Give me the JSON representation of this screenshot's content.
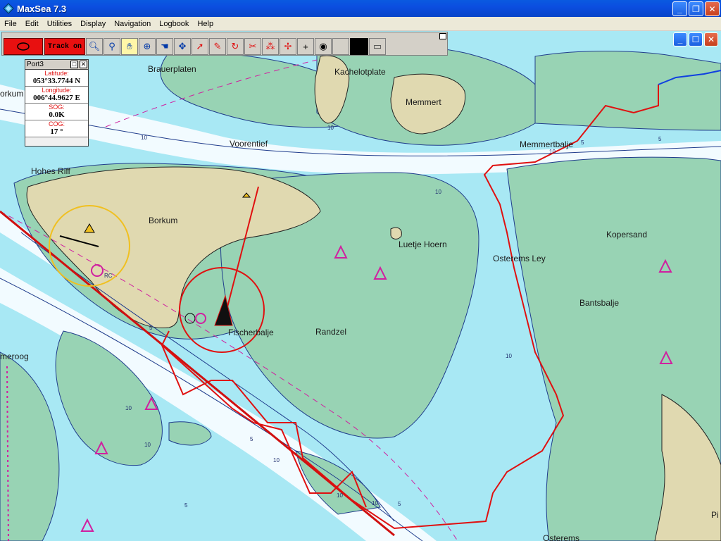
{
  "window": {
    "title": "MaxSea 7.3"
  },
  "menu": [
    "File",
    "Edit",
    "Utilities",
    "Display",
    "Navigation",
    "Logbook",
    "Help"
  ],
  "toolbar": {
    "track_label": "Track on",
    "tools": [
      "zoom-icon",
      "compass-icon",
      "hand-icon",
      "crosshair-icon",
      "hand-icon",
      "route-icon",
      "pointer-icon",
      "pencil-icon",
      "cycle-icon",
      "scissors-icon",
      "scatter-icon",
      "move-icon",
      "plus-icon",
      "target-icon"
    ]
  },
  "gps_panel": {
    "title": "Port3",
    "latitude_label": "Latitude:",
    "latitude": "053°33.7744 N",
    "longitude_label": "Longitude:",
    "longitude": "006°44.9627 E",
    "sog_label": "SOG:",
    "sog": "0.0K",
    "cog_label": "COG:",
    "cog": "17 °"
  },
  "map": {
    "places": {
      "brauerplaten": "Brauerplaten",
      "kachelotplate": "Kachelotplate",
      "memmert": "Memmert",
      "voorentief": "Voorentief",
      "memmertbalje": "Memmertbalje",
      "hohes_riff": "Hohes Riff",
      "borkum": "Borkum",
      "luetje_hoern": "Luetje Hoern",
      "kopersand": "Kopersand",
      "osterems_ley": "Osterems Ley",
      "bantsbalje": "Bantsbalje",
      "fischerbalje": "Fischerbalje",
      "randzel": "Randzel",
      "osterems": "Osterems",
      "borkum_edge": "orkum",
      "meroog": "meroog",
      "pi": "Pi",
      "rc": "RC"
    },
    "depths": [
      "10",
      "10",
      "5",
      "10",
      "10",
      "5",
      "10",
      "5",
      "10",
      "10",
      "5",
      "10",
      "5",
      "10",
      "10",
      "5"
    ]
  }
}
